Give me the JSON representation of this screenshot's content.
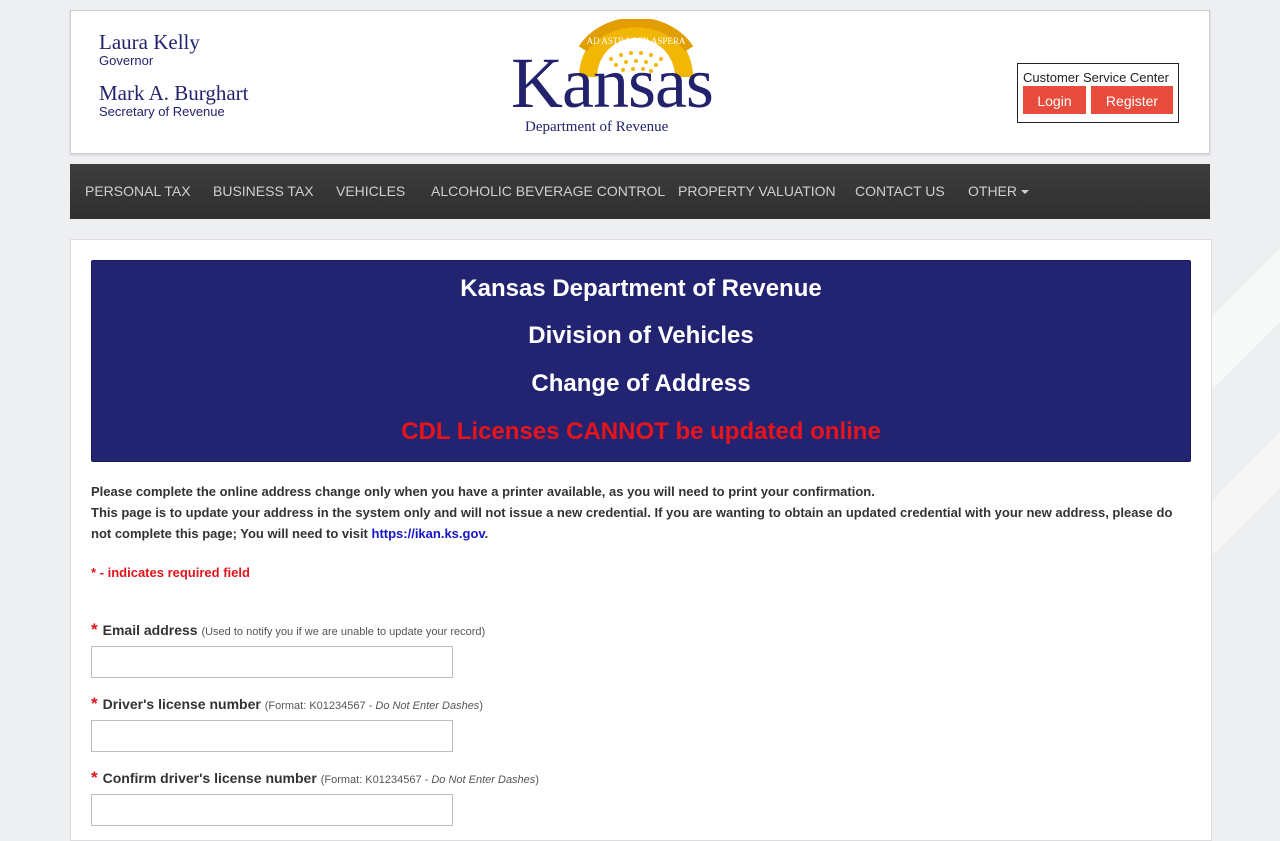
{
  "header": {
    "governor_name": "Laura Kelly",
    "governor_title": "Governor",
    "secretary_name": "Mark A. Burghart",
    "secretary_title": "Secretary of Revenue",
    "logo_word": "Kansas",
    "logo_motto": "AD ASTRA PER ASPERA",
    "logo_dept": "Department of Revenue",
    "customer_service": {
      "label": "Customer Service Center",
      "login": "Login",
      "register": "Register"
    }
  },
  "nav": {
    "items": [
      "PERSONAL TAX",
      "BUSINESS TAX",
      "VEHICLES",
      "ALCOHOLIC BEVERAGE CONTROL",
      "PROPERTY VALUATION",
      "CONTACT US",
      "OTHER"
    ]
  },
  "banner": {
    "line1": "Kansas Department of Revenue",
    "line2": "Division of Vehicles",
    "line3": "Change of Address",
    "warning": "CDL Licenses CANNOT be updated online"
  },
  "intro": {
    "p1": "Please complete the online address change only when you have a printer available, as you will need to print your confirmation.",
    "p2": "This page is to update your address in the system only and will not issue a new credential. If you are wanting to obtain an updated credential with your new address, please do not complete this page; You will need to visit ",
    "link": "https://ikan.ks.gov",
    "p2_end": "."
  },
  "required_note": "* - indicates required field",
  "form": {
    "email": {
      "star": "*",
      "label": "Email address",
      "hint": "(Used to notify you if we are unable to update your record)",
      "value": ""
    },
    "license": {
      "star": "*",
      "label": "Driver's license number",
      "hint_prefix": "(Format: K01234567 - ",
      "hint_em": "Do Not Enter Dashes",
      "hint_suffix": ")",
      "value": ""
    },
    "confirm_license": {
      "star": "*",
      "label": "Confirm driver's license number",
      "hint_prefix": "(Format: K01234567 - ",
      "hint_em": "Do Not Enter Dashes",
      "hint_suffix": ")",
      "value": ""
    }
  },
  "colors": {
    "navy": "#222472",
    "accent_red": "#e74c3c",
    "required_red": "#e0141b",
    "nav_bg": "#333333"
  }
}
